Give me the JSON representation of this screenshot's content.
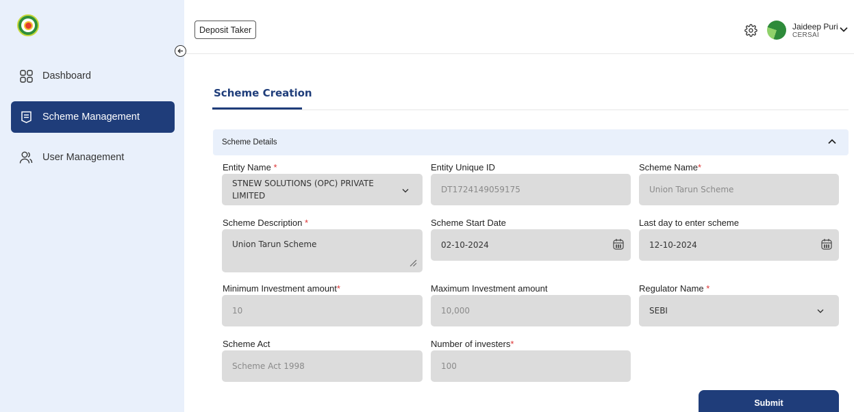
{
  "app": {
    "logo_text": "CERSAI"
  },
  "sidebar": {
    "items": [
      {
        "label": "Dashboard",
        "icon": "grid-icon",
        "active": false
      },
      {
        "label": "Scheme Management",
        "icon": "document-list-icon",
        "active": true
      },
      {
        "label": "User Management",
        "icon": "users-icon",
        "active": false
      }
    ]
  },
  "header": {
    "role_label": "Deposit Taker",
    "user": {
      "name": "Jaideep Puri",
      "org": "CERSAI"
    }
  },
  "page": {
    "title": "Scheme Creation"
  },
  "section": {
    "title": "Scheme Details",
    "expanded": true
  },
  "form": {
    "entity_name": {
      "label": "Entity Name",
      "required": "*",
      "value": "STNEW SOLUTIONS (OPC) PRIVATE LIMITED"
    },
    "entity_unique_id": {
      "label": "Entity Unique ID",
      "value": "DT1724149059175"
    },
    "scheme_name": {
      "label": "Scheme Name",
      "required": "*",
      "value": "Union Tarun Scheme"
    },
    "scheme_description": {
      "label": "Scheme Description",
      "required": "*",
      "value": "Union Tarun Scheme"
    },
    "scheme_start_date": {
      "label": "Scheme Start Date",
      "value": "02-10-2024"
    },
    "last_day": {
      "label": "Last day to enter scheme",
      "value": "12-10-2024"
    },
    "min_investment": {
      "label": "Minimum Investment amount",
      "required": "*",
      "value": "10"
    },
    "max_investment": {
      "label": "Maximum Investment amount",
      "value": "10,000"
    },
    "regulator_name": {
      "label": "Regulator Name",
      "required": "*",
      "value": "SEBI"
    },
    "scheme_act": {
      "label": "Scheme Act",
      "value": "Scheme Act 1998"
    },
    "num_investors": {
      "label": "Number of investers",
      "required": "*",
      "value": "100"
    }
  },
  "actions": {
    "submit_label": "Submit"
  },
  "colors": {
    "primary": "#1f3d7a",
    "sidebar_bg": "#e9f0fb",
    "field_bg": "#dcdcdc",
    "required": "#d33"
  }
}
